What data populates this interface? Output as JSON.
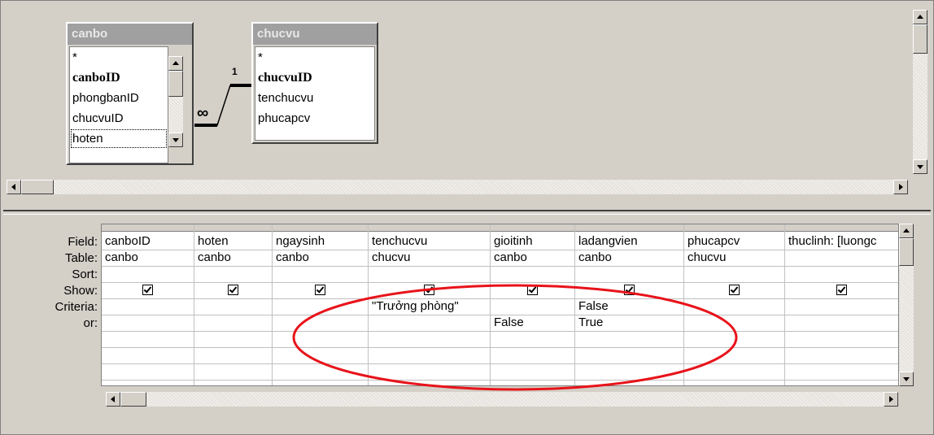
{
  "tables": [
    {
      "title": "canbo",
      "fields": [
        "*",
        "canboID",
        "phongbanID",
        "chucvuID",
        "hoten"
      ],
      "key": "canboID"
    },
    {
      "title": "chucvu",
      "fields": [
        "*",
        "chucvuID",
        "tenchucvu",
        "phucapcv"
      ],
      "key": "chucvuID"
    }
  ],
  "relationship": {
    "one": "1",
    "many": "∞"
  },
  "grid": {
    "row_labels": [
      "Field:",
      "Table:",
      "Sort:",
      "Show:",
      "Criteria:",
      "or:"
    ],
    "columns": [
      {
        "field": "canboID",
        "table": "canbo",
        "show": true,
        "criteria": "",
        "or": ""
      },
      {
        "field": "hoten",
        "table": "canbo",
        "show": true,
        "criteria": "",
        "or": ""
      },
      {
        "field": "ngaysinh",
        "table": "canbo",
        "show": true,
        "criteria": "",
        "or": ""
      },
      {
        "field": "tenchucvu",
        "table": "chucvu",
        "show": true,
        "criteria": "\"Trưởng phòng\"",
        "or": ""
      },
      {
        "field": "gioitinh",
        "table": "canbo",
        "show": true,
        "criteria": "",
        "or": "False"
      },
      {
        "field": "ladangvien",
        "table": "canbo",
        "show": true,
        "criteria": "False",
        "or": "True"
      },
      {
        "field": "phucapcv",
        "table": "chucvu",
        "show": true,
        "criteria": "",
        "or": ""
      },
      {
        "field": "thuclinh: [luongc",
        "table": "",
        "show": true,
        "criteria": "",
        "or": ""
      }
    ]
  },
  "colors": {
    "annotation": "#e8131a",
    "background": "#d4d0c8"
  }
}
